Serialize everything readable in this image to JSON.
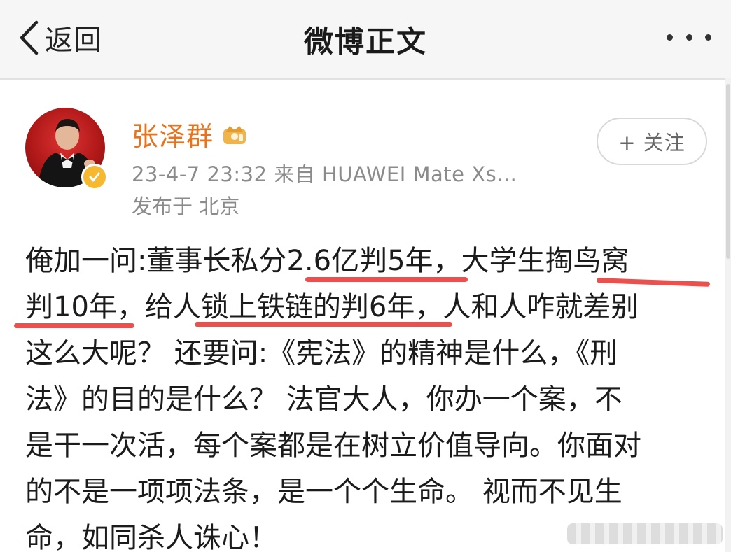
{
  "header": {
    "back_label": "返回",
    "title": "微博正文",
    "more_icon": "more-dots-icon"
  },
  "post": {
    "username": "张泽群",
    "meta": "23-4-7 23:32  来自 HUAWEI Mate Xs...",
    "location": "发布于 北京",
    "follow_label": "+ 关注",
    "lines": [
      "俺加一问:董事长私分2.6亿判5年，大学生掏鸟窝",
      "判10年，给人锁上铁链的判6年，人和人咋就差别",
      "这么大呢？ 还要问:《宪法》的精神是什么，《刑",
      "法》的目的是什么？ 法官大人，你办一个案，不",
      "是干一次活，每个案都是在树立价值导向。你面对",
      "的不是一项项法条，是一个个生命。 视而不见生",
      "命，如同杀人诛心！"
    ]
  },
  "colors": {
    "username": "#e8731d",
    "meta_text": "#8b8b8b",
    "highlight_underline": "#e8413f",
    "verified_badge": "#f5b82e",
    "avatar_bg": "#b01818"
  }
}
